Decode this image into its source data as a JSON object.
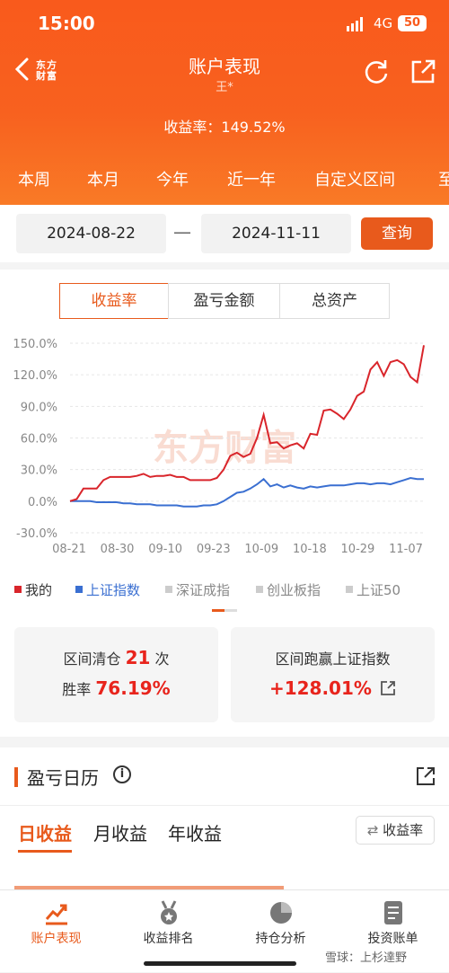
{
  "status_bar": {
    "time": "15:00",
    "network": "4G",
    "battery": "50"
  },
  "nav": {
    "logo": "东方财富",
    "title": "账户表现",
    "subtitle": "王*"
  },
  "summary": {
    "label": "收益率：",
    "value": "149.52%"
  },
  "period_tabs": [
    "本周",
    "本月",
    "今年",
    "近一年",
    "自定义区间",
    "至"
  ],
  "date_range": {
    "start": "2024-08-22",
    "separator": "—",
    "end": "2024-11-11",
    "query_label": "查询"
  },
  "segments": [
    "收益率",
    "盈亏金额",
    "总资产"
  ],
  "chart_data": {
    "type": "line",
    "ylim": [
      -30,
      150
    ],
    "y_ticks": [
      "150.0%",
      "120.0%",
      "90.0%",
      "60.0%",
      "30.0%",
      "0.0%",
      "-30.0%"
    ],
    "x_ticks": [
      "08-21",
      "08-30",
      "09-10",
      "09-23",
      "10-09",
      "10-18",
      "10-29",
      "11-07"
    ],
    "watermark": "东方财富",
    "series": [
      {
        "name": "我的",
        "color": "#d9252b",
        "values": [
          0,
          2,
          12,
          12,
          12,
          20,
          23,
          23,
          23,
          23,
          24,
          26,
          23,
          24,
          24,
          25,
          23,
          23,
          20,
          20,
          20,
          20,
          22,
          30,
          43,
          46,
          42,
          45,
          60,
          82,
          55,
          56,
          50,
          53,
          55,
          50,
          64,
          63,
          86,
          87,
          83,
          78,
          87,
          100,
          104,
          125,
          132,
          119,
          132,
          134,
          130,
          118,
          113,
          148
        ]
      },
      {
        "name": "上证指数",
        "color": "#3a6fd1",
        "values": [
          0,
          0,
          0,
          0,
          -1,
          -1,
          -1,
          -1,
          -2,
          -2,
          -3,
          -3,
          -3,
          -4,
          -4,
          -4,
          -4,
          -5,
          -5,
          -5,
          -4,
          -4,
          -3,
          0,
          4,
          8,
          9,
          12,
          16,
          21,
          14,
          16,
          13,
          15,
          13,
          12,
          14,
          13,
          14,
          15,
          15,
          15,
          16,
          17,
          17,
          16,
          17,
          17,
          16,
          18,
          20,
          22,
          21,
          21
        ]
      }
    ]
  },
  "legend": [
    {
      "label": "我的",
      "color": "#d9252b"
    },
    {
      "label": "上证指数",
      "color": "#3a6fd1"
    },
    {
      "label": "深证成指",
      "color": "#cccccc"
    },
    {
      "label": "创业板指",
      "color": "#cccccc"
    },
    {
      "label": "上证50",
      "color": "#cccccc"
    }
  ],
  "stats": {
    "left": {
      "prefix": "区间清仓",
      "count": "21",
      "unit": "次",
      "win_label": "胜率",
      "win_value": "76.19%"
    },
    "right": {
      "label": "区间跑赢上证指数",
      "value": "+128.01%"
    }
  },
  "calendar": {
    "title": "盈亏日历",
    "tabs": [
      "日收益",
      "月收益",
      "年收益"
    ],
    "sort_label": "收益率"
  },
  "bottom_nav": [
    "账户表现",
    "收益排名",
    "持仓分析",
    "投资账单"
  ],
  "watermark_text": "雪球：上杉達野"
}
